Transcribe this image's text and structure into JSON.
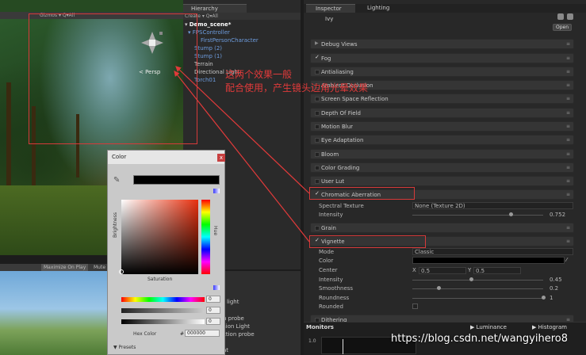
{
  "scene": {
    "toolbar_label": "Gizmos ▾  Q▾All",
    "persp_label": "< Persp"
  },
  "game": {
    "maximize_label": "Maximize On Play",
    "mute_label": "Mute"
  },
  "hierarchy": {
    "tab_label": "Hierarchy",
    "create_label": "Create ▾  Q▾All",
    "items": [
      {
        "label": "Demo_scene*",
        "color": "#ffffff",
        "indent": 0
      },
      {
        "label": "FPSController",
        "color": "#6e9ddf",
        "indent": 1
      },
      {
        "label": "FirstPersonCharacter",
        "color": "#6e9ddf",
        "indent": 2
      },
      {
        "label": "Stump (2)",
        "color": "#6e9ddf",
        "indent": 1
      },
      {
        "label": "Stump (1)",
        "color": "#6e9ddf",
        "indent": 1
      },
      {
        "label": "Terrain",
        "color": "#c8c8c8",
        "indent": 1
      },
      {
        "label": "Directional Light",
        "color": "#c8c8c8",
        "indent": 1
      },
      {
        "label": "Torch01",
        "color": "#6e9ddf",
        "indent": 1
      }
    ],
    "lower_items": [
      "t light",
      "n probe",
      "sion Light",
      "ction probe",
      "at"
    ]
  },
  "annotation": {
    "line1": "这两个效果一般",
    "line2": "配合使用，产生镜头边角光晕效果"
  },
  "inspector": {
    "tab_inspector": "Inspector",
    "tab_lighting": "Lighting",
    "object_name": "Ivy",
    "open_label": "Open",
    "effects": [
      {
        "label": "Debug Views",
        "checked": false,
        "arrow": true
      },
      {
        "label": "Fog",
        "checked": true
      },
      {
        "label": "Antialiasing",
        "checked": false
      },
      {
        "label": "Ambient Occlusion",
        "checked": false
      },
      {
        "label": "Screen Space Reflection",
        "checked": false
      },
      {
        "label": "Depth Of Field",
        "checked": false
      },
      {
        "label": "Motion Blur",
        "checked": false
      },
      {
        "label": "Eye Adaptation",
        "checked": false
      },
      {
        "label": "Bloom",
        "checked": false
      },
      {
        "label": "Color Grading",
        "checked": false
      },
      {
        "label": "User Lut",
        "checked": false
      },
      {
        "label": "Chromatic Aberration",
        "checked": true
      },
      {
        "label": "Grain",
        "checked": false
      },
      {
        "label": "Vignette",
        "checked": true
      },
      {
        "label": "Dithering",
        "checked": false
      }
    ],
    "chromatic": {
      "spectral_label": "Spectral Texture",
      "spectral_value": "None (Texture 2D)",
      "intensity_label": "Intensity",
      "intensity_value": "0.752",
      "intensity_fraction": 0.752
    },
    "vignette": {
      "mode_label": "Mode",
      "mode_value": "Classic",
      "color_label": "Color",
      "center_label": "Center",
      "center_x_label": "X",
      "center_x": "0.5",
      "center_y_label": "Y",
      "center_y": "0.5",
      "intensity_label": "Intensity",
      "intensity_value": "0.45",
      "intensity_fraction": 0.45,
      "smoothness_label": "Smoothness",
      "smoothness_value": "0.2",
      "smoothness_fraction": 0.2,
      "roundness_label": "Roundness",
      "roundness_value": "1",
      "roundness_fraction": 1,
      "rounded_label": "Rounded"
    },
    "monitors": {
      "title": "Monitors",
      "luminance": "Luminance",
      "histogram": "Histogram",
      "axis_value": "1.0"
    }
  },
  "color_picker": {
    "title": "Color",
    "close": "x",
    "saturation_label": "Saturation",
    "brightness_label": "Brightness",
    "hue_label": "Hue",
    "sliders": [
      {
        "value": "0",
        "gradient": "linear-gradient(to right,#f00,#ff0,#0f0,#0ff,#00f,#f0f,#f00)"
      },
      {
        "value": "0",
        "gradient": "linear-gradient(to right,#222,#ccc)"
      },
      {
        "value": "0",
        "gradient": "linear-gradient(to right,#000,#fff)"
      }
    ],
    "hex_label": "Hex Color",
    "hex_prefix": "#",
    "hex_value": "000000",
    "presets_label": "▼ Presets"
  },
  "watermark": "https://blog.csdn.net/wangyihero8",
  "colors": {
    "annotation_red": "#d63a3a",
    "hierarchy_blue": "#6e9ddf"
  }
}
